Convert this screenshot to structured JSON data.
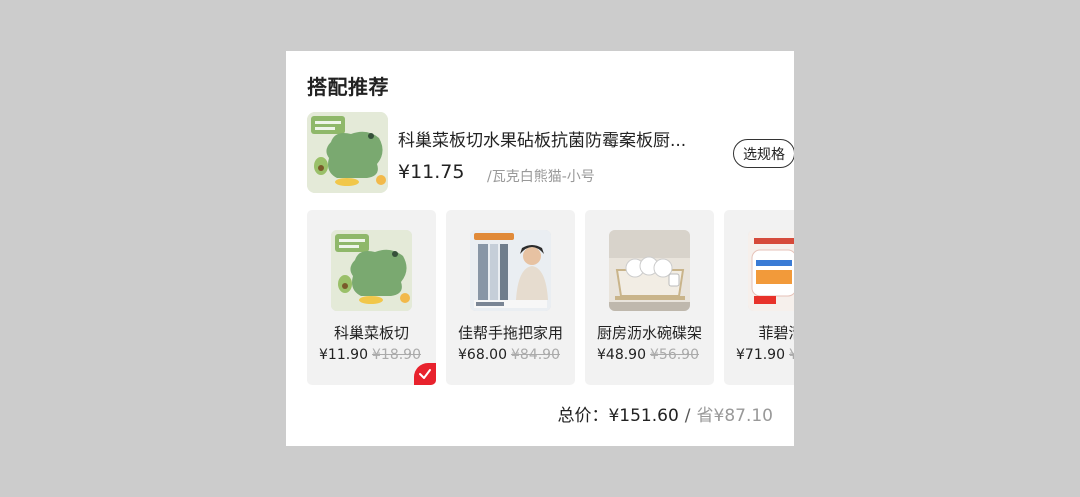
{
  "title": "搭配推荐",
  "featured": {
    "name": "科巢菜板切水果砧板抗菌防霉案板厨...",
    "price": "¥11.75",
    "variant": "/瓦克白熊猫-小号",
    "spec_button": "选规格"
  },
  "items": [
    {
      "name": "科巢菜板切",
      "price": "¥11.90",
      "original": "¥18.90",
      "selected": true,
      "icon": "cutting-board-image"
    },
    {
      "name": "佳帮手拖把家用",
      "price": "¥68.00",
      "original": "¥84.90",
      "selected": false,
      "icon": "mop-image"
    },
    {
      "name": "厨房沥水碗碟架",
      "price": "¥48.90",
      "original": "¥56.90",
      "selected": false,
      "icon": "dish-rack-image"
    },
    {
      "name": "菲碧清不",
      "price": "¥71.90",
      "original": "¥",
      "selected": false,
      "icon": "cleaner-image"
    }
  ],
  "total": {
    "label": "总价：",
    "value": "¥151.60",
    "separator": "/",
    "saved": "省¥87.10"
  },
  "colors": {
    "accent_red": "#e8222d",
    "card_bg": "#f2f2f2"
  }
}
